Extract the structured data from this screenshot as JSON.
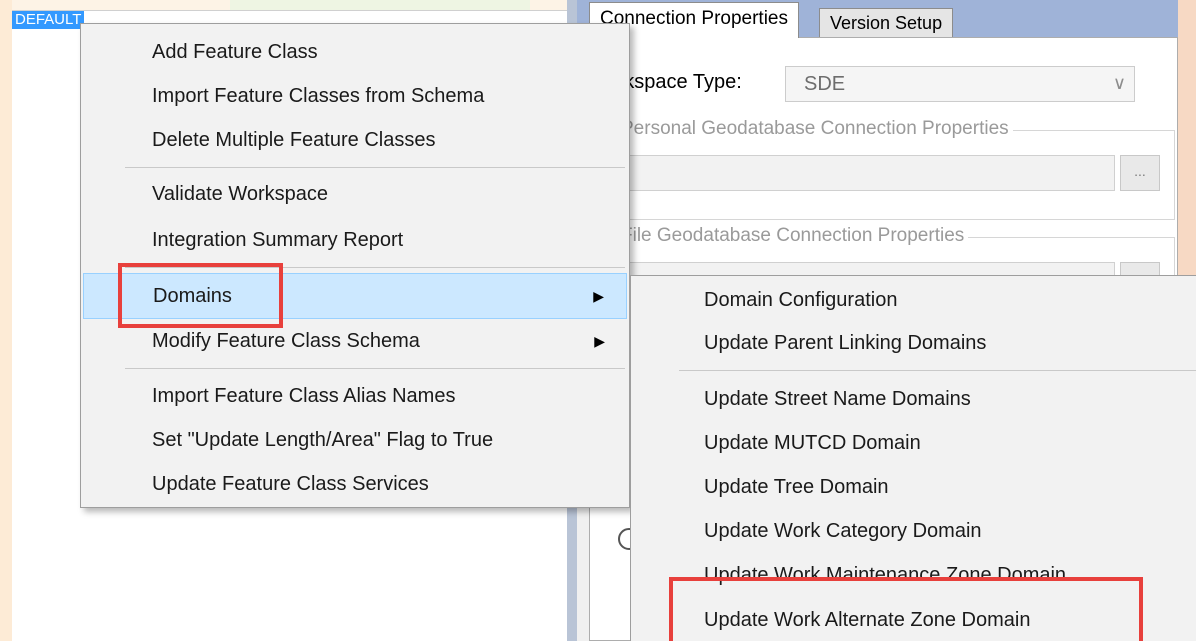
{
  "tree": {
    "selected_node": "DEFAULT"
  },
  "tabs": [
    {
      "label": "Connection Properties",
      "active": true
    },
    {
      "label": "Version Setup",
      "active": false
    }
  ],
  "connection": {
    "workspace_type_label": "Workspace Type:",
    "workspace_type_value": "SDE",
    "personal_group_title": "Personal Geodatabase Connection Properties",
    "file_group_title": "File Geodatabase Connection Properties",
    "browse_label": "..."
  },
  "context_menu": {
    "groups": [
      [
        "Add Feature Class",
        "Import Feature Classes from Schema",
        "Delete Multiple Feature Classes"
      ],
      [
        "Validate Workspace",
        "Integration Summary Report"
      ],
      [
        "Domains",
        "Modify Feature Class Schema"
      ],
      [
        "Import Feature Class Alias Names",
        "Set \"Update Length/Area\" Flag to True",
        "Update Feature Class Services"
      ]
    ],
    "highlighted_item": "Domains"
  },
  "domains_submenu": {
    "groups": [
      [
        "Domain Configuration",
        "Update Parent Linking Domains"
      ],
      [
        "Update Street Name Domains",
        "Update MUTCD Domain",
        "Update Tree Domain",
        "Update Work Category Domain",
        "Update Work Maintenance Zone Domain",
        "Update Work Alternate Zone Domain"
      ]
    ],
    "highlighted_item": "Update Work Alternate Zone Domain"
  },
  "colors": {
    "selection_blue": "#3399ff",
    "menu_hover": "#cce8ff",
    "annotation_red": "#e8403c"
  }
}
